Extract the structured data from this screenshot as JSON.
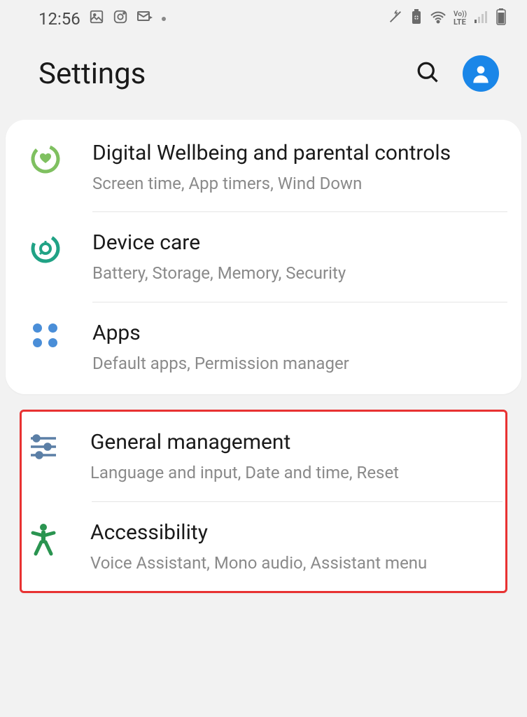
{
  "status": {
    "time": "12:56"
  },
  "header": {
    "title": "Settings"
  },
  "groups": [
    {
      "items": [
        {
          "title": "Digital Wellbeing and parental controls",
          "subtitle": "Screen time, App timers, Wind Down"
        },
        {
          "title": "Device care",
          "subtitle": "Battery, Storage, Memory, Security"
        },
        {
          "title": "Apps",
          "subtitle": "Default apps, Permission manager"
        }
      ]
    },
    {
      "highlighted": true,
      "items": [
        {
          "title": "General management",
          "subtitle": "Language and input, Date and time, Reset"
        },
        {
          "title": "Accessibility",
          "subtitle": "Voice Assistant, Mono audio, Assistant menu"
        }
      ]
    }
  ]
}
